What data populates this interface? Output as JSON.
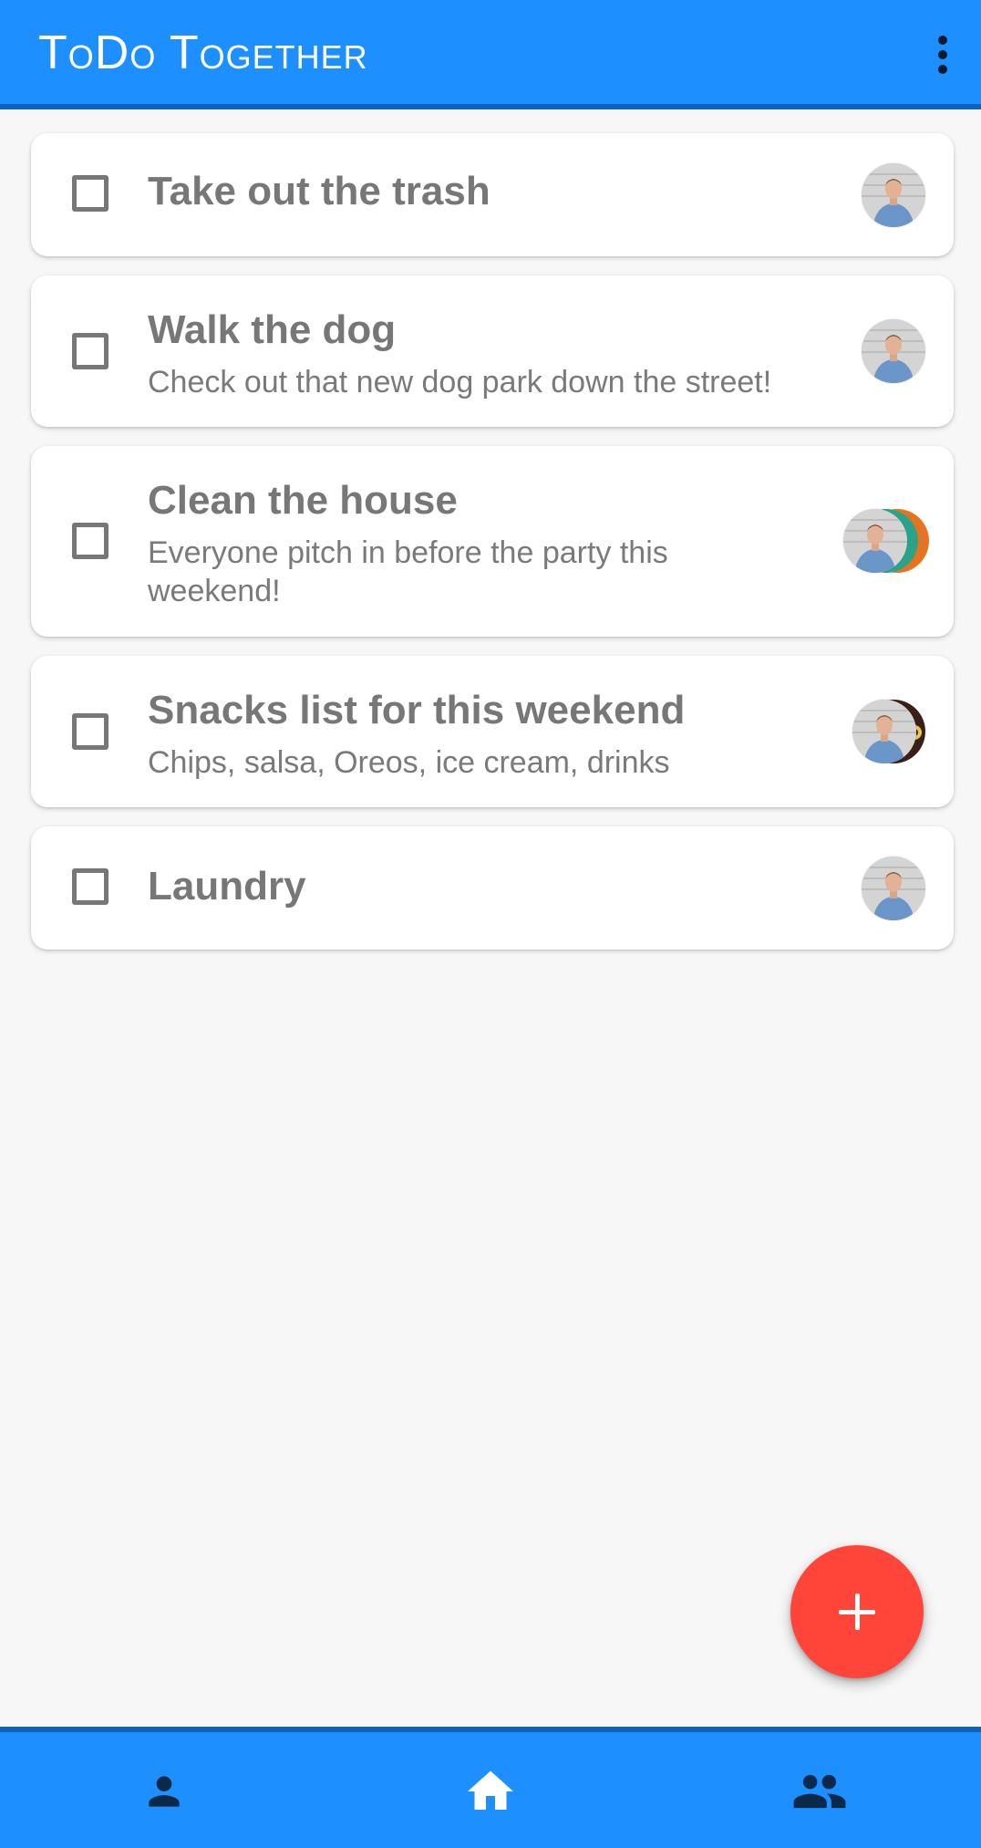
{
  "app_bar": {
    "title": "ToDo Together",
    "menu_icon": "more-vert-icon",
    "background_color": "#1e8fff"
  },
  "tasks": [
    {
      "title": "Take out the trash",
      "description": "",
      "assignee_icon": "avatar"
    },
    {
      "title": "Walk the dog",
      "description": "Check out that new dog park down the street!",
      "assignee_icon": "avatar"
    },
    {
      "title": "Clean the house",
      "description": "Everyone pitch in before the party this weekend!",
      "assignee_icon": "avatar-stack"
    },
    {
      "title": "Snacks list for this weekend",
      "description": "Chips, salsa, Oreos, ice cream, drinks",
      "assignee_icon": "avatar-stack"
    },
    {
      "title": "Laundry",
      "description": "",
      "assignee_icon": "avatar"
    }
  ],
  "fab": {
    "icon": "plus-icon",
    "color": "#ff4539"
  },
  "bottom_nav": {
    "items": [
      {
        "icon": "person-icon"
      },
      {
        "icon": "home-icon"
      },
      {
        "icon": "group-icon"
      }
    ],
    "background_color": "#1e8fff"
  }
}
